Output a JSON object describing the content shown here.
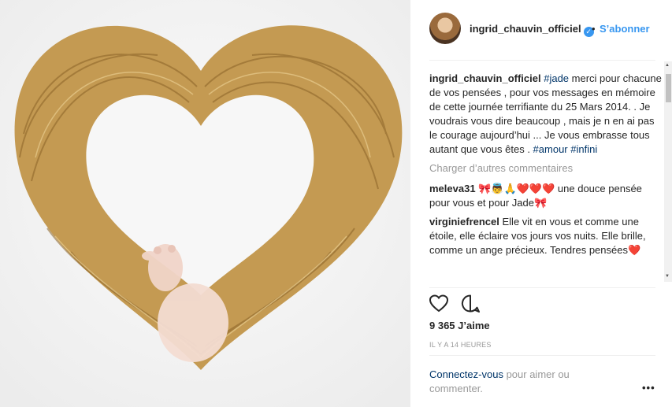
{
  "post": {
    "username": "ingrid_chauvin_officiel",
    "separator": "•",
    "follow_label": "S’abonner",
    "caption_user": "ingrid_chauvin_officiel",
    "caption_tag": "#jade",
    "caption_text": " merci pour chacune de vos pensées , pour vos messages en mémoire de cette journée terrifiante du 25 Mars 2014. . Je voudrais vous dire beaucoup , mais je n en ai pas le courage aujourd’hui ... Je vous embrasse tous autant que vous êtes . ",
    "caption_tags_end": [
      "#amour",
      "#infini"
    ],
    "load_more": "Charger d’autres commentaires",
    "comments": [
      {
        "user": "meleva31",
        "text": "🎀👼🙏❤️❤️❤️ une douce pensée pour vous et pour Jade🎀"
      },
      {
        "user": "virginiefrencel",
        "text": "Elle vit en vous et comme une étoile, elle éclaire vos jours vos nuits. Elle brille, comme un ange précieux. Tendres pensées❤️"
      }
    ],
    "likes": "9 365 J’aime",
    "time": "IL Y A 14 HEURES",
    "login_link": "Connectez-vous",
    "login_text": " pour aimer ou commenter.",
    "more_options": "•••"
  },
  "colors": {
    "link": "#3897f0",
    "tag": "#003569",
    "muted": "#999999"
  },
  "icons": [
    "heart-icon",
    "comment-icon",
    "verified-badge-icon",
    "more-options-icon"
  ]
}
